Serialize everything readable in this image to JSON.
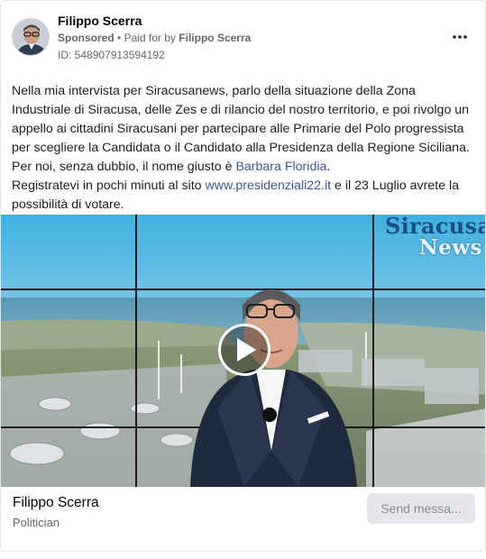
{
  "post": {
    "page_name": "Filippo Scerra",
    "sponsored_label": "Sponsored",
    "separator": "•",
    "paid_for_prefix": "Paid for by",
    "paid_for_by": "Filippo Scerra",
    "ad_id": "ID: 548907913594192",
    "more_icon": "more-horizontal-icon"
  },
  "body": {
    "line1": "Nella mia intervista per Siracusanews, parlo della situazione della Zona Industriale di Siracusa, delle Zes e di rilancio del nostro territorio, e poi rivolgo un appello ai cittadini Siracusani per partecipare alle Primarie del Polo progressista per scegliere la Candidata o il Candidato alla Presidenza della Regione Siciliana.",
    "line2_prefix": "Per noi, senza dubbio, il nome giusto è ",
    "line2_link": "Barbara Floridia",
    "line2_suffix": ".",
    "line3_prefix": "Registratevi in pochi minuti al sito ",
    "line3_link": "www.presidenziali22.it",
    "line3_suffix": " e il 23 Luglio avrete la possibilità di votare."
  },
  "media": {
    "logo_line1": "Siracusa",
    "logo_line2": "News",
    "play_icon": "play-icon"
  },
  "footer": {
    "name": "Filippo Scerra",
    "category": "Politician",
    "send_button": "Send messa..."
  },
  "colors": {
    "link": "#385898",
    "secondary_text": "#65676b",
    "button_bg": "#e4e6eb"
  }
}
